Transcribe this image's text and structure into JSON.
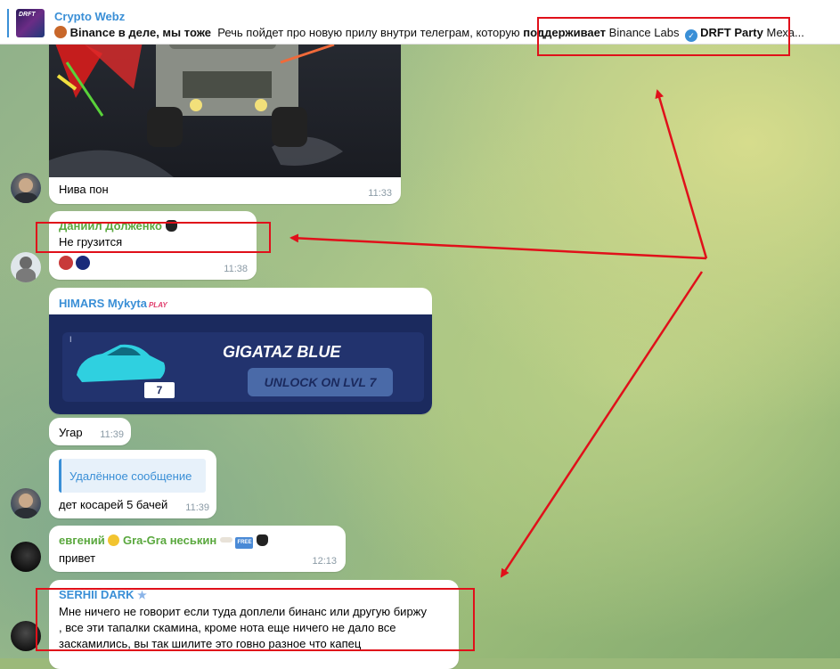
{
  "header": {
    "thumb_label": "DRFT",
    "channel": "Crypto Webz",
    "preview_bold_1": "Binance в деле, мы тоже",
    "preview_text_1": "Речь пойдет про новую прилу внутри телеграм, которую",
    "preview_bold_2": "поддерживает",
    "preview_text_2": "Binance Labs",
    "preview_bold_3": "DRFT Party",
    "preview_text_3": "Меха..."
  },
  "messages": [
    {
      "text": "Нива пон",
      "time": "11:33"
    },
    {
      "author": "Даниил Долженко",
      "text": "Не грузится",
      "time": "11:38"
    },
    {
      "author": "HIMARS Mykyta",
      "author_badge": "PLAY",
      "card_title": "GIGATAZ BLUE",
      "card_button": "UNLOCK ON LVL 7",
      "card_level": "7",
      "card_corner": "I"
    },
    {
      "text": "Угар",
      "time": "11:39"
    },
    {
      "reply_text": "Удалённое сообщение",
      "text": "дет косарей 5 бачей",
      "time": "11:39"
    },
    {
      "author": "евгений",
      "author_2": "Gra-Gra неськин",
      "free_badge": "FREE",
      "text": "привет",
      "time": "12:13"
    },
    {
      "author": "SERHII DARK",
      "text": "Мне ничего не говорит если туда доплели бинанс или другую биржу , все эти тапалки скамина, кроме нота еще ничего не дало все заскамились, вы так шилите это говно разное что капец"
    }
  ],
  "colors": {
    "accent": "#3a8fd6",
    "annotation_red": "#e0101a",
    "author_green": "#5aa83e",
    "author_blue": "#3a8fd6",
    "card_bg": "#1b2a5e"
  }
}
